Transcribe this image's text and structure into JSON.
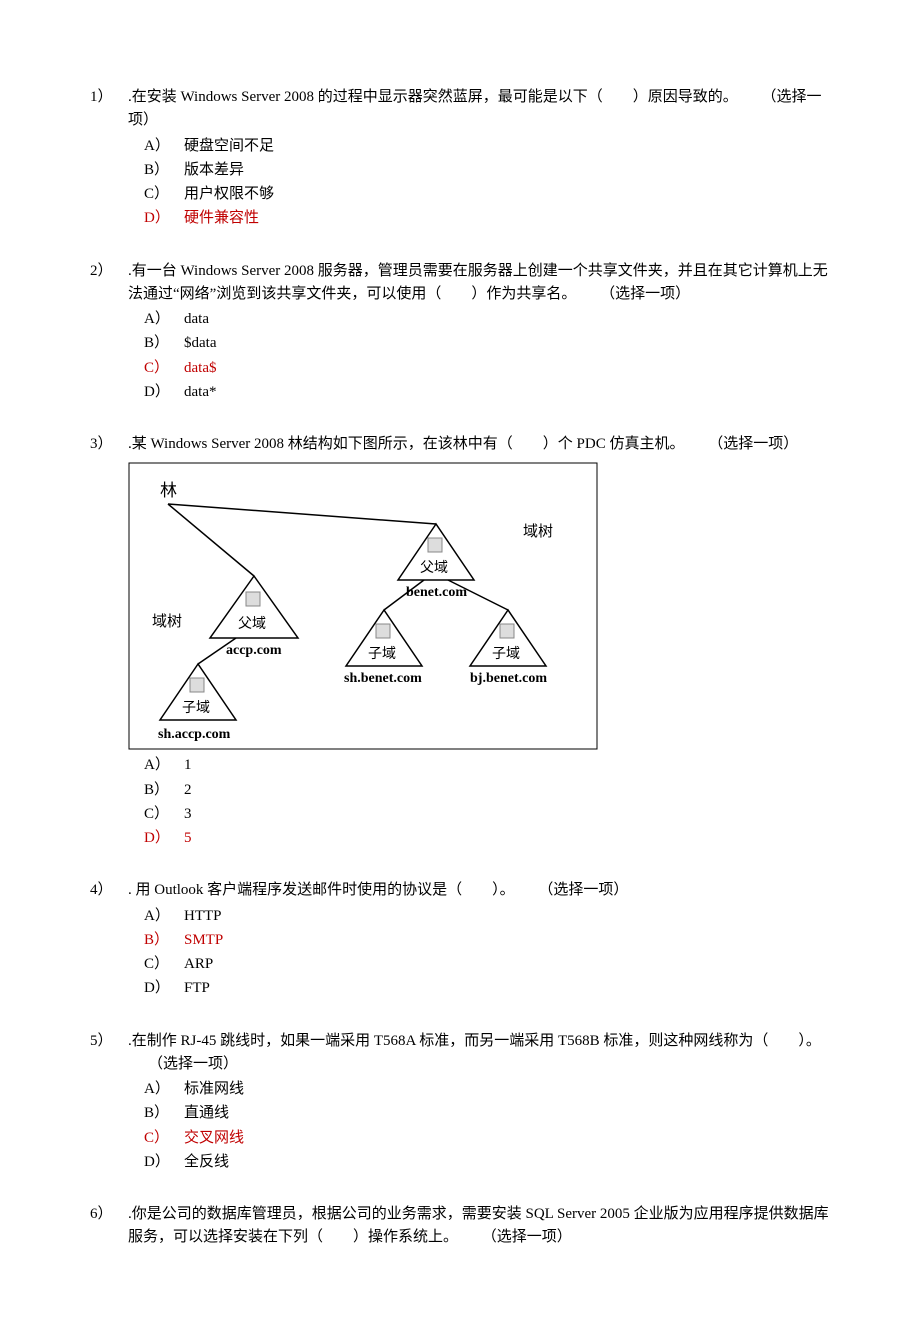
{
  "questions": [
    {
      "num": "1）",
      "text": ".在安装 Windows Server 2008 的过程中显示器突然蓝屏，最可能是以下（　　）原因导致的。",
      "hint": "（选择一项）",
      "options": [
        {
          "label": "A）",
          "text": "硬盘空间不足",
          "correct": false
        },
        {
          "label": "B）",
          "text": "版本差异",
          "correct": false
        },
        {
          "label": "C）",
          "text": "用户权限不够",
          "correct": false
        },
        {
          "label": "D）",
          "text": "硬件兼容性",
          "correct": true
        }
      ]
    },
    {
      "num": "2）",
      "text": ".有一台 Windows Server 2008 服务器，管理员需要在服务器上创建一个共享文件夹，并且在其它计算机上无法通过“网络”浏览到该共享文件夹，可以使用（　　）作为共享名。",
      "hint": "（选择一项）",
      "options": [
        {
          "label": "A）",
          "text": "data",
          "correct": false
        },
        {
          "label": "B）",
          "text": "$data",
          "correct": false
        },
        {
          "label": "C）",
          "text": "data$",
          "correct": true
        },
        {
          "label": "D）",
          "text": "data*",
          "correct": false
        }
      ]
    },
    {
      "num": "3）",
      "text": ".某 Windows Server 2008 林结构如下图所示，在该林中有（　　）个 PDC 仿真主机。",
      "hint": "（选择一项）",
      "diagram": {
        "labels": {
          "forest": "林",
          "tree_left": "域树",
          "tree_right": "域树",
          "parent_left": "父域",
          "parent_right": "父域",
          "child": "子域",
          "accp": "accp.com",
          "sh_accp": "sh.accp.com",
          "benet": "benet.com",
          "sh_benet": "sh.benet.com",
          "bj_benet": "bj.benet.com"
        }
      },
      "options": [
        {
          "label": "A）",
          "text": "1",
          "correct": false
        },
        {
          "label": "B）",
          "text": "2",
          "correct": false
        },
        {
          "label": "C）",
          "text": "3",
          "correct": false
        },
        {
          "label": "D）",
          "text": "5",
          "correct": true
        }
      ]
    },
    {
      "num": "4）",
      "text": ". 用 Outlook 客户端程序发送邮件时使用的协议是（　　）。",
      "hint": "（选择一项）",
      "options": [
        {
          "label": "A）",
          "text": "HTTP",
          "correct": false
        },
        {
          "label": "B）",
          "text": "SMTP",
          "correct": true
        },
        {
          "label": "C）",
          "text": "ARP",
          "correct": false
        },
        {
          "label": "D）",
          "text": "FTP",
          "correct": false
        }
      ]
    },
    {
      "num": "5）",
      "text": ".在制作 RJ-45 跳线时，如果一端采用 T568A 标准，而另一端采用 T568B 标准，则这种网线称为（　　）。",
      "hint": "（选择一项）",
      "options": [
        {
          "label": "A）",
          "text": "标准网线",
          "correct": false
        },
        {
          "label": "B）",
          "text": "直通线",
          "correct": false
        },
        {
          "label": "C）",
          "text": "交叉网线",
          "correct": true
        },
        {
          "label": "D）",
          "text": "全反线",
          "correct": false
        }
      ]
    },
    {
      "num": "6）",
      "text": ".你是公司的数据库管理员，根据公司的业务需求，需要安装 SQL Server 2005 企业版为应用程序提供数据库服务，可以选择安装在下列（　　）操作系统上。",
      "hint": "（选择一项）",
      "options": []
    }
  ]
}
